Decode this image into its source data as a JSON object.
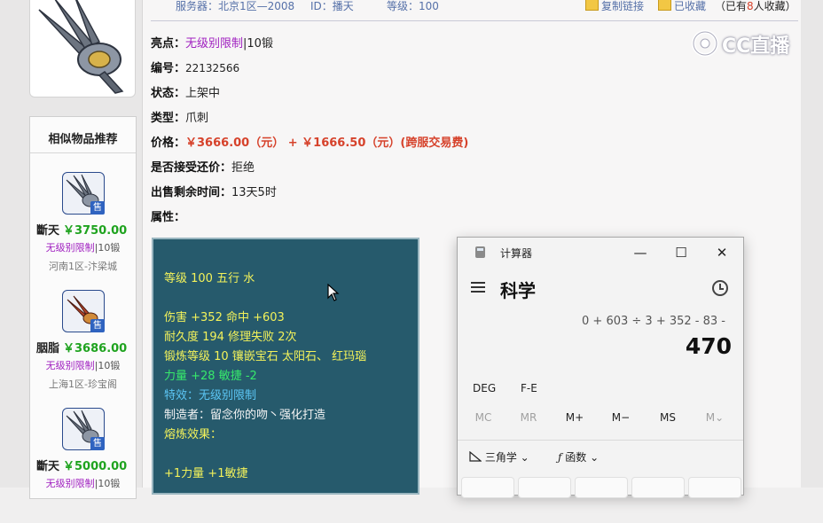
{
  "header": {
    "server": "服务器：北京1区—2008",
    "id": "ID：播天",
    "level": "等级：100",
    "copy_link": "复制链接",
    "favorited": "已收藏",
    "fav_count_prefix": "（已有",
    "fav_count": "8",
    "fav_count_suffix": "人收藏）"
  },
  "details": {
    "highlight_label": "亮点：",
    "highlight_value": "无级别限制",
    "highlight_extra": "|10锻",
    "serial_label": "编号：",
    "serial_value": "22132566",
    "status_label": "状态：",
    "status_value": "上架中",
    "type_label": "类型：",
    "type_value": "爪刺",
    "price_label": "价格：",
    "price_value": "￥3666.00（元） + ￥1666.50（元）(跨服交易费)",
    "bargain_label": "是否接受还价：",
    "bargain_value": "拒绝",
    "time_label": "出售剩余时间：",
    "time_value": "13天5时",
    "attr_label": "属性："
  },
  "recommend": {
    "title": "相似物品推荐",
    "sale_tag": "售",
    "items": [
      {
        "name": "斷天",
        "price": "￥3750.00",
        "tag": "无级别限制",
        "tag_extra": "|10锻",
        "server": "河南1区-汴梁城"
      },
      {
        "name": "胭脂",
        "price": "￥3686.00",
        "tag": "无级别限制",
        "tag_extra": "|10锻",
        "server": "上海1区-珍宝阁"
      },
      {
        "name": "斷天",
        "price": "￥5000.00",
        "tag": "无级别限制",
        "tag_extra": "|10锻",
        "server": ""
      }
    ]
  },
  "attributes": {
    "line1": "等级 100 五行 水",
    "line2": "伤害 +352 命中 +603",
    "line3": "耐久度 194 修理失败 2次",
    "line4": "锻炼等级 10 镶嵌宝石 太阳石、 红玛瑙",
    "line5": "力量 +28 敏捷 -2",
    "line6": "特效：无级别限制",
    "line7": "制造者：留念你的吻丶强化打造",
    "line8": "熔炼效果：",
    "line9": "+1力量 +1敏捷"
  },
  "watermark": "CC直播",
  "calculator": {
    "app_title": "计算器",
    "mode": "科学",
    "expression": "0 + 603 ÷ 3 + 352 - 83 -",
    "result": "470",
    "angle_deg": "DEG",
    "angle_fe": "F-E",
    "mem": [
      "MC",
      "MR",
      "M+",
      "M−",
      "MS",
      "M⌄"
    ],
    "trig": "三角学",
    "func": "函数",
    "window_min": "—",
    "window_max": "☐",
    "window_close": "✕"
  },
  "colors": {
    "attr_bg": "#265a6c",
    "price_red": "#d6422b",
    "tag_purple": "#a020c0",
    "rec_price_green": "#1fa31f"
  }
}
